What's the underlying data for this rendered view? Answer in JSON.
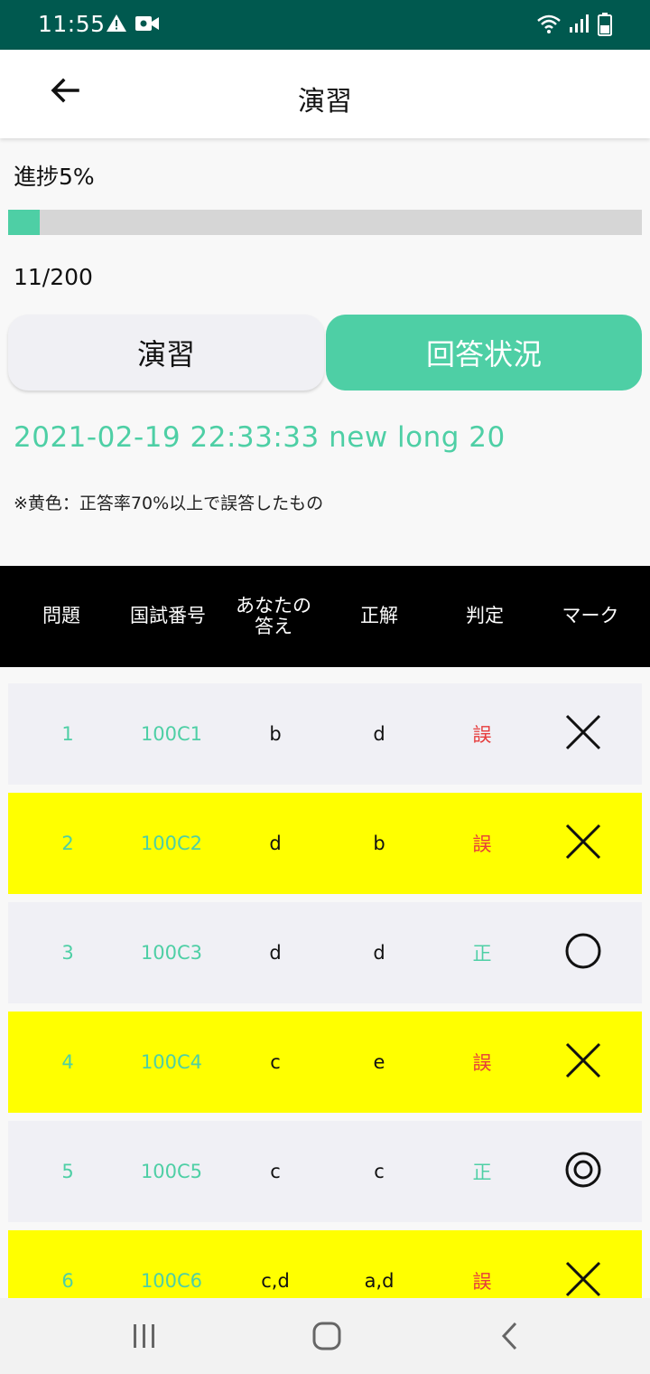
{
  "status_bar": {
    "time": "11:55"
  },
  "app_bar": {
    "title": "演習"
  },
  "progress": {
    "label": "進捗5%",
    "fraction": 0.05,
    "count": "11/200"
  },
  "tabs": [
    {
      "label": "演習",
      "active": false
    },
    {
      "label": "回答状況",
      "active": true
    }
  ],
  "session_title": "2021-02-19 22:33:33 new long 20",
  "note": "※黄色：正答率70%以上で誤答したもの",
  "table": {
    "headers": {
      "num": "問題",
      "code": "国試番号",
      "answer_line1": "あなたの",
      "answer_line2": "答え",
      "correct": "正解",
      "judge": "判定",
      "mark": "マーク"
    },
    "rows": [
      {
        "num": "1",
        "code": "100C1",
        "answer": "b",
        "correct": "d",
        "judge": "誤",
        "mark": "cross-icon",
        "highlight": false
      },
      {
        "num": "2",
        "code": "100C2",
        "answer": "d",
        "correct": "b",
        "judge": "誤",
        "mark": "cross-icon",
        "highlight": true
      },
      {
        "num": "3",
        "code": "100C3",
        "answer": "d",
        "correct": "d",
        "judge": "正",
        "mark": "circle-icon",
        "highlight": false
      },
      {
        "num": "4",
        "code": "100C4",
        "answer": "c",
        "correct": "e",
        "judge": "誤",
        "mark": "cross-icon",
        "highlight": true
      },
      {
        "num": "5",
        "code": "100C5",
        "answer": "c",
        "correct": "c",
        "judge": "正",
        "mark": "double-circle-icon",
        "highlight": false
      },
      {
        "num": "6",
        "code": "100C6",
        "answer": "c,d",
        "correct": "a,d",
        "judge": "誤",
        "mark": "cross-icon",
        "highlight": true
      }
    ]
  },
  "colors": {
    "status_bar": "#00594f",
    "accent": "#4ecfa5",
    "wrong": "#e63b3b",
    "highlight_row": "#ffff00",
    "normal_row": "#f0f0f5",
    "header_bg": "#000000"
  }
}
